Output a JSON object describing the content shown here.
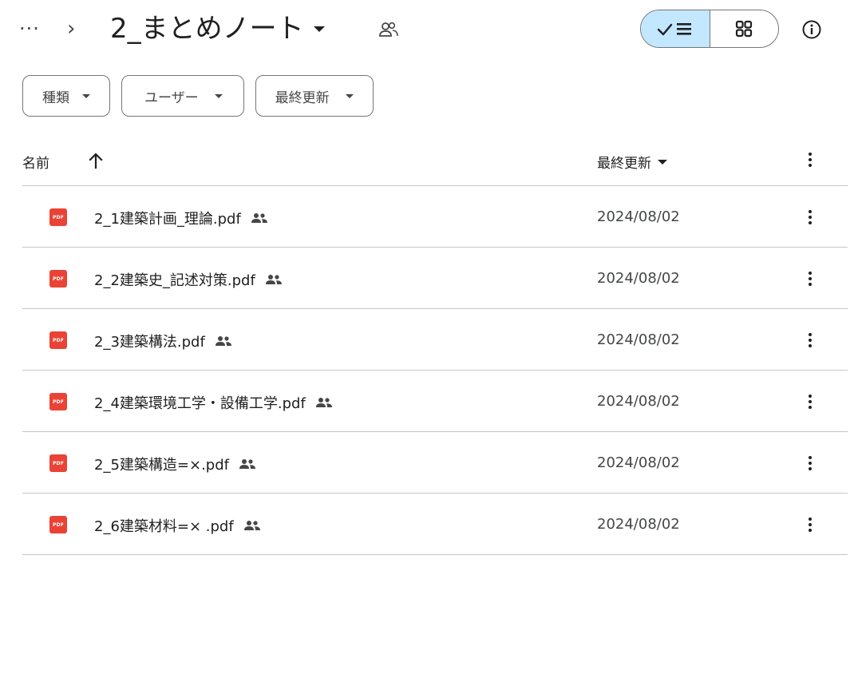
{
  "header": {
    "more_label": "···",
    "separator": "›",
    "folder_name": "2_まとめノート"
  },
  "view_toggle": {
    "active": "list",
    "options": [
      "list",
      "grid"
    ]
  },
  "filters": [
    {
      "label": "種類"
    },
    {
      "label": "ユーザー"
    },
    {
      "label": "最終更新"
    }
  ],
  "columns": {
    "name": "名前",
    "modified": "最終更新"
  },
  "files": [
    {
      "name": "2_1建築計画_理論.pdf",
      "modified": "2024/08/02",
      "icon": "pdf-icon",
      "shared": true
    },
    {
      "name": "2_2建築史_記述対策.pdf",
      "modified": "2024/08/02",
      "icon": "pdf-icon",
      "shared": true
    },
    {
      "name": "2_3建築構法.pdf",
      "modified": "2024/08/02",
      "icon": "pdf-icon",
      "shared": true
    },
    {
      "name": "2_4建築環境工学・設備工学.pdf",
      "modified": "2024/08/02",
      "icon": "pdf-icon",
      "shared": true
    },
    {
      "name": "2_5建築構造=×.pdf",
      "modified": "2024/08/02",
      "icon": "pdf-icon",
      "shared": true
    },
    {
      "name": "2_6建築材料=× .pdf",
      "modified": "2024/08/02",
      "icon": "pdf-icon",
      "shared": true
    }
  ],
  "colors": {
    "accent": "#c2e7ff",
    "pdf": "#ea4335",
    "divider": "#c4c7c5",
    "outline": "#747775",
    "text": "#1f1f1f",
    "text_secondary": "#444746"
  }
}
